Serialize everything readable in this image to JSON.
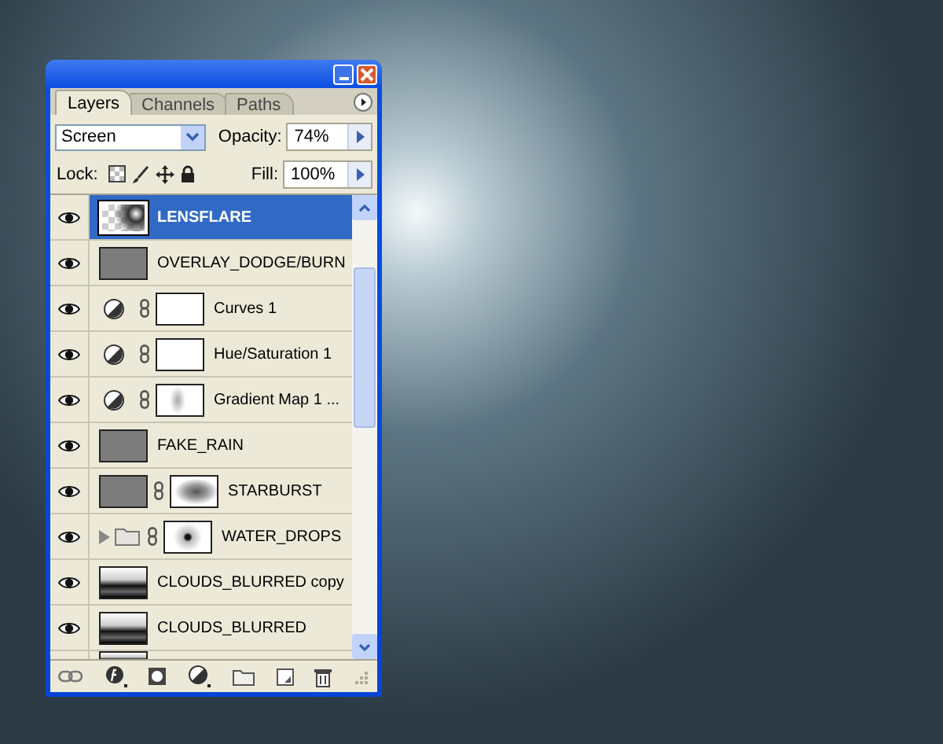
{
  "panel": {
    "tabs": [
      {
        "label": "Layers",
        "selected": true
      },
      {
        "label": "Channels",
        "selected": false
      },
      {
        "label": "Paths",
        "selected": false
      }
    ],
    "blend_mode": "Screen",
    "opacity_label": "Opacity:",
    "opacity": "74%",
    "lock_label": "Lock:",
    "fill_label": "Fill:",
    "fill": "100%"
  },
  "layers": [
    {
      "name": "LENSFLARE",
      "kind": "pixel",
      "visible": true,
      "selected": true
    },
    {
      "name": "OVERLAY_DODGE/BURN",
      "kind": "pixel",
      "visible": true,
      "selected": false
    },
    {
      "name": "Curves 1",
      "kind": "adjustment",
      "visible": true,
      "selected": false
    },
    {
      "name": "Hue/Saturation 1",
      "kind": "adjustment",
      "visible": true,
      "selected": false
    },
    {
      "name": "Gradient Map 1 ...",
      "kind": "adjustment",
      "visible": true,
      "selected": false
    },
    {
      "name": "FAKE_RAIN",
      "kind": "pixel",
      "visible": true,
      "selected": false
    },
    {
      "name": "STARBURST",
      "kind": "masked",
      "visible": true,
      "selected": false
    },
    {
      "name": "WATER_DROPS",
      "kind": "group",
      "visible": true,
      "selected": false
    },
    {
      "name": "CLOUDS_BLURRED copy",
      "kind": "pixel",
      "visible": true,
      "selected": false
    },
    {
      "name": "CLOUDS_BLURRED",
      "kind": "pixel",
      "visible": true,
      "selected": false
    }
  ]
}
